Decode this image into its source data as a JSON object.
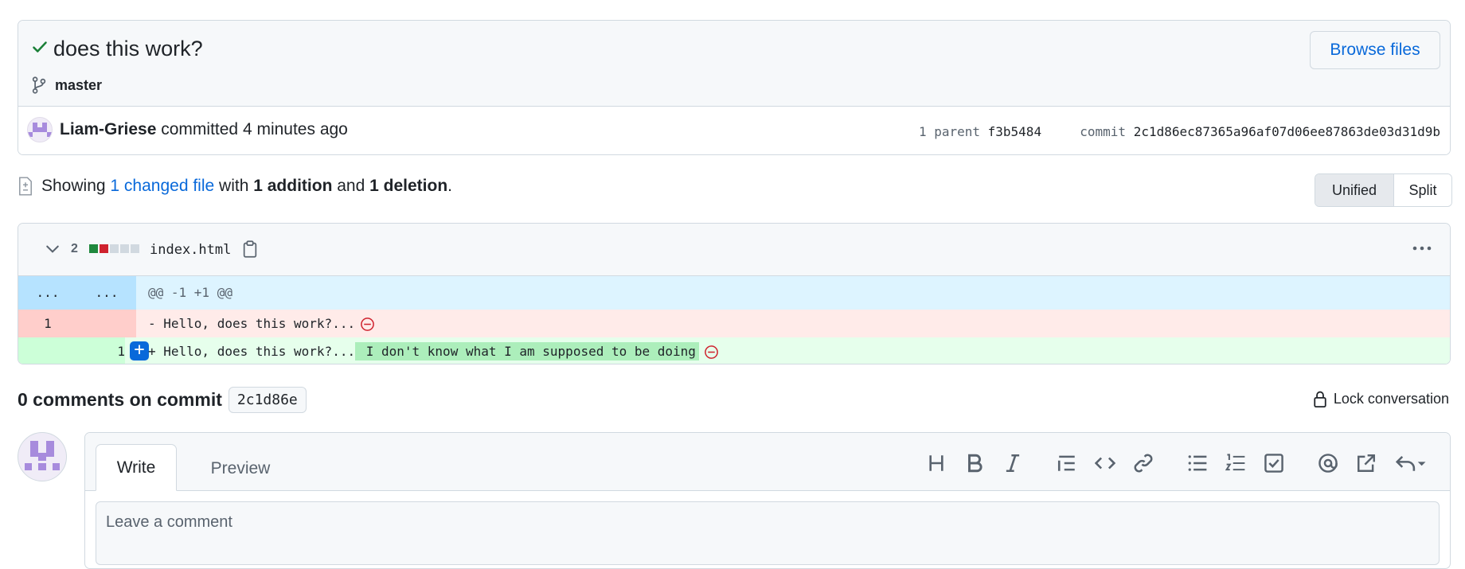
{
  "commit": {
    "title": "does this work?",
    "branch": "master",
    "browse_label": "Browse files",
    "author": "Liam-Griese",
    "action": "committed",
    "time": "4 minutes ago",
    "parent_label": "1 parent",
    "parent_sha": "f3b5484",
    "commit_label": "commit",
    "commit_sha": "2c1d86ec87365a96af07d06ee87863de03d31d9b"
  },
  "summary": {
    "prefix": "Showing",
    "changed_files": "1 changed file",
    "with": "with",
    "additions": "1 addition",
    "and": "and",
    "deletions": "1 deletion",
    "suffix": "."
  },
  "view_toggle": {
    "unified": "Unified",
    "split": "Split",
    "selected": "Unified"
  },
  "diff": {
    "count": "2",
    "filename": "index.html",
    "hunk": {
      "left": "...",
      "right": "...",
      "text": "@@ -1 +1 @@"
    },
    "deleted_line": {
      "num": "1",
      "text": "- Hello, does this work?..."
    },
    "added_line": {
      "num": "1",
      "prefix": "+ Hello, does this work?...",
      "highlight": " I don't know what I am supposed to be doing"
    },
    "blocks": [
      "#1f883d",
      "#cf222e",
      "#d1d9e0",
      "#d1d9e0",
      "#d1d9e0"
    ],
    "add_comment_symbol": "+"
  },
  "comments": {
    "count_label": "0 comments on commit",
    "short_sha": "2c1d86e",
    "lock_label": "Lock conversation"
  },
  "editor": {
    "write_tab": "Write",
    "preview_tab": "Preview",
    "placeholder": "Leave a comment",
    "toolbar": [
      "heading-icon",
      "bold-icon",
      "italic-icon",
      "quote-icon",
      "code-icon",
      "link-icon",
      "bulleted-list-icon",
      "numbered-list-icon",
      "task-list-icon",
      "mention-icon",
      "reference-icon",
      "reply-icon"
    ]
  },
  "colors": {
    "accent": "#0969da",
    "success": "#1a7f37",
    "danger": "#cf222e"
  }
}
